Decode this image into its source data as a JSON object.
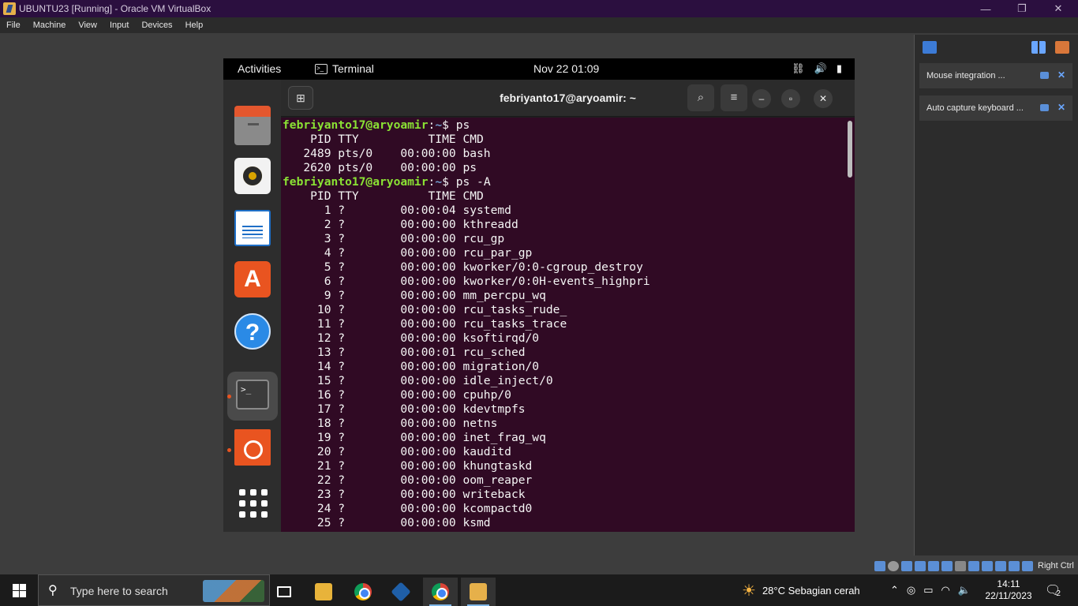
{
  "vbox": {
    "window_title": "UBUNTU23 [Running] - Oracle VM VirtualBox",
    "menu": [
      "File",
      "Machine",
      "View",
      "Input",
      "Devices",
      "Help"
    ],
    "minimize": "—",
    "restore": "❐",
    "close": "✕",
    "notifications": [
      {
        "text": "Mouse integration ..."
      },
      {
        "text": "Auto capture keyboard ..."
      }
    ],
    "status_host_key": "Right Ctrl",
    "colors": {
      "title_bg": "#2b0f3f",
      "sidebar_bg": "#2c2c2c"
    }
  },
  "guest": {
    "topbar": {
      "activities": "Activities",
      "app_name": "Terminal",
      "clock": "Nov 22  01:09",
      "tray_icons": [
        "network-icon",
        "volume-icon",
        "battery-icon"
      ]
    },
    "dock": [
      "files-icon",
      "rhythmbox-icon",
      "libreoffice-writer-icon",
      "app-center-icon",
      "help-icon",
      "terminal-icon",
      "ubuntu-installer-icon",
      "show-apps-icon"
    ],
    "terminal": {
      "title": "febriyanto17@aryoamir: ~",
      "prompt_user": "febriyanto17@aryoamir",
      "prompt_path": "~",
      "cmd1": "ps",
      "cmd2": "ps -A",
      "header": "    PID TTY          TIME CMD",
      "ps_rows": [
        "   2489 pts/0    00:00:00 bash",
        "   2620 pts/0    00:00:00 ps"
      ],
      "psA_rows": [
        "      1 ?        00:00:04 systemd",
        "      2 ?        00:00:00 kthreadd",
        "      3 ?        00:00:00 rcu_gp",
        "      4 ?        00:00:00 rcu_par_gp",
        "      5 ?        00:00:00 kworker/0:0-cgroup_destroy",
        "      6 ?        00:00:00 kworker/0:0H-events_highpri",
        "      9 ?        00:00:00 mm_percpu_wq",
        "     10 ?        00:00:00 rcu_tasks_rude_",
        "     11 ?        00:00:00 rcu_tasks_trace",
        "     12 ?        00:00:00 ksoftirqd/0",
        "     13 ?        00:00:01 rcu_sched",
        "     14 ?        00:00:00 migration/0",
        "     15 ?        00:00:00 idle_inject/0",
        "     16 ?        00:00:00 cpuhp/0",
        "     17 ?        00:00:00 kdevtmpfs",
        "     18 ?        00:00:00 netns",
        "     19 ?        00:00:00 inet_frag_wq",
        "     20 ?        00:00:00 kauditd",
        "     21 ?        00:00:00 khungtaskd",
        "     22 ?        00:00:00 oom_reaper",
        "     23 ?        00:00:00 writeback",
        "     24 ?        00:00:00 kcompactd0",
        "     25 ?        00:00:00 ksmd"
      ],
      "colors": {
        "bg": "#300a24",
        "user": "#8ae234",
        "path": "#729fcf"
      }
    }
  },
  "taskbar": {
    "search_placeholder": "Type here to search",
    "weather": "28°C  Sebagian cerah",
    "time": "14:11",
    "date": "22/11/2023",
    "notif_count": "2"
  }
}
